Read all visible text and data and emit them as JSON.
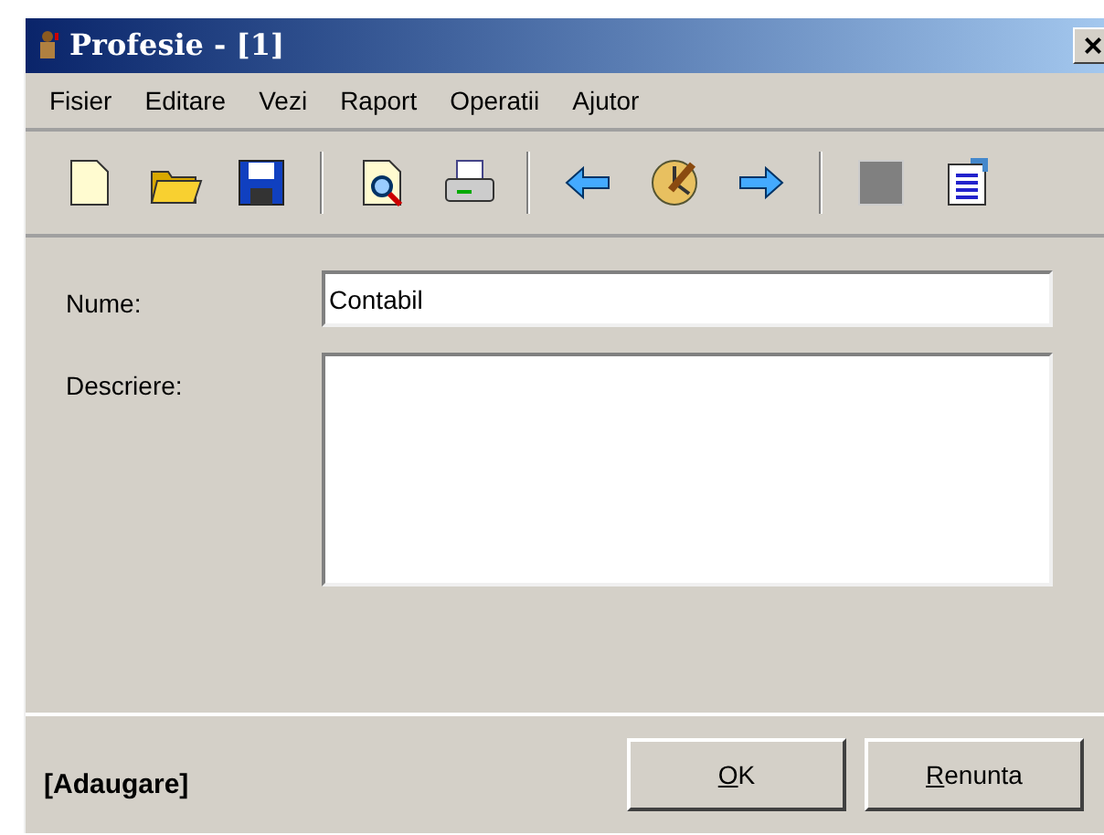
{
  "window": {
    "title": "Profesie - [1]",
    "close": "×"
  },
  "menu": [
    {
      "label": "Fisier"
    },
    {
      "label": "Editare"
    },
    {
      "label": "Vezi"
    },
    {
      "label": "Raport"
    },
    {
      "label": "Operatii"
    },
    {
      "label": "Ajutor"
    }
  ],
  "toolbar": [
    {
      "kind": "new"
    },
    {
      "kind": "open"
    },
    {
      "kind": "save"
    },
    {
      "kind": "separator"
    },
    {
      "kind": "preview"
    },
    {
      "kind": "print"
    },
    {
      "kind": "separator"
    },
    {
      "kind": "back"
    },
    {
      "kind": "clock"
    },
    {
      "kind": "forward"
    },
    {
      "kind": "separator"
    },
    {
      "kind": "stop"
    },
    {
      "kind": "properties"
    }
  ],
  "form": {
    "fields": [
      {
        "label": "Nume:",
        "value": "Contabil",
        "kind": "line"
      },
      {
        "label": "Descriere:",
        "kind": "area"
      }
    ]
  },
  "status": "[Adaugare]",
  "buttons": [
    {
      "label": "OK",
      "underline_first": true
    },
    {
      "label": "Renunta",
      "underline_first": true
    }
  ]
}
